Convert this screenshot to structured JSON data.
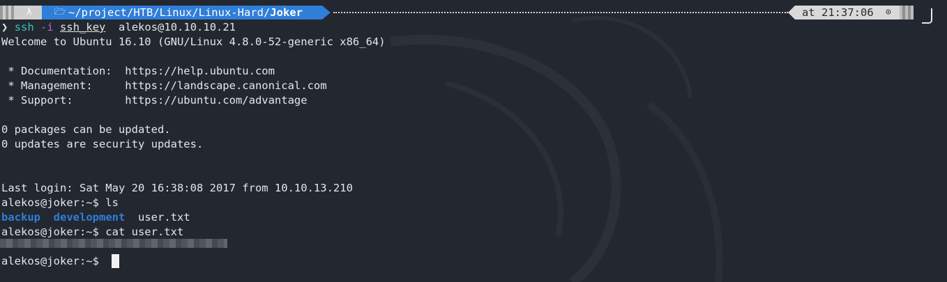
{
  "prompt_bar": {
    "os_icon": "linux-penguin-icon",
    "folder_icon": "folder-icon",
    "path_prefix": "~/project/HTB/Linux/Linux-Hard/",
    "path_current": "Joker",
    "time_label": "at 21:37:06",
    "clock_icon": "clock-icon"
  },
  "lines": {
    "cmd": {
      "chevron": "❯",
      "ssh": "ssh",
      "flag": "-i",
      "key": "ssh_key",
      "target": "alekos@10.10.10.21"
    },
    "welcome": "Welcome to Ubuntu 16.10 (GNU/Linux 4.8.0-52-generic x86_64)",
    "doc": " * Documentation:  https://help.ubuntu.com",
    "mgmt": " * Management:     https://landscape.canonical.com",
    "support": " * Support:        https://ubuntu.com/advantage",
    "packages": "0 packages can be updated.",
    "security": "0 updates are security updates.",
    "last_login": "Last login: Sat May 20 16:38:08 2017 from 10.10.13.210",
    "prompt_ls": "alekos@joker:~$ ls",
    "ls_output": {
      "dir1": "backup",
      "dir2": "development",
      "file1": "user.txt"
    },
    "prompt_cat": "alekos@joker:~$ cat user.txt",
    "prompt_final": "alekos@joker:~$ "
  },
  "colors": {
    "background": "#232730",
    "path_segment": "#2f7ed8",
    "ssh_command": "#3cc3b5",
    "flag": "#c061cb",
    "directory": "#2f7ed8"
  }
}
